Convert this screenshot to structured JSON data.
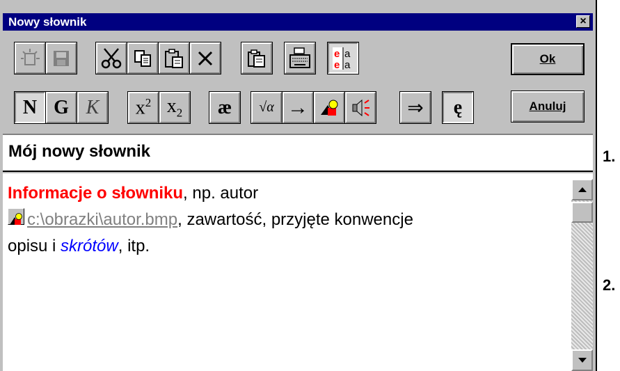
{
  "window": {
    "title": "Nowy słownik",
    "close_glyph": "×"
  },
  "toolbar": {
    "row1": [
      {
        "name": "new-entry-icon",
        "state": "disabled"
      },
      {
        "name": "save-icon",
        "state": "disabled"
      },
      {
        "name": "cut-icon",
        "state": "normal"
      },
      {
        "name": "copy-icon",
        "state": "normal"
      },
      {
        "name": "paste-icon",
        "state": "normal"
      },
      {
        "name": "delete-icon",
        "state": "normal",
        "glyph": "✕"
      },
      {
        "name": "duplicate-icon",
        "state": "normal"
      },
      {
        "name": "keyboard-icon",
        "state": "normal"
      },
      {
        "name": "swap-languages-icon",
        "state": "normal",
        "letters": [
          "e",
          "a",
          "e",
          "a"
        ]
      }
    ],
    "row2": [
      {
        "name": "bold-normal-N",
        "glyph": "N"
      },
      {
        "name": "bold-G",
        "glyph": "G"
      },
      {
        "name": "italic-K",
        "glyph": "K"
      },
      {
        "name": "superscript",
        "base": "x",
        "mark": "2"
      },
      {
        "name": "subscript",
        "base": "x",
        "mark": "2"
      },
      {
        "name": "special-char-ae",
        "glyph": "æ"
      },
      {
        "name": "formula-icon",
        "glyph": "√α"
      },
      {
        "name": "link-arrow-icon",
        "glyph": "→"
      },
      {
        "name": "insert-image-icon"
      },
      {
        "name": "insert-sound-icon"
      },
      {
        "name": "double-arrow-icon",
        "glyph": "⇒"
      },
      {
        "name": "special-char-e-ogonek",
        "glyph": "ę"
      }
    ]
  },
  "buttons": {
    "ok_label": "Ok",
    "cancel_label": "Anuluj"
  },
  "dictionary": {
    "name": "Mój nowy słownik",
    "info": {
      "highlight": "Informacje o słowniku",
      "text1": ", np. autor",
      "image_path": "c:\\obrazki\\autor.bmp",
      "text2": ", zawartość, przyjęte konwencje",
      "text3": "opisu i ",
      "italic": "skrótów",
      "text4": ", itp."
    }
  },
  "side_numbers": [
    "1.",
    "2."
  ],
  "colors": {
    "title_bar": "#000080",
    "highlight": "#ff0000",
    "link": "#0000ff"
  }
}
